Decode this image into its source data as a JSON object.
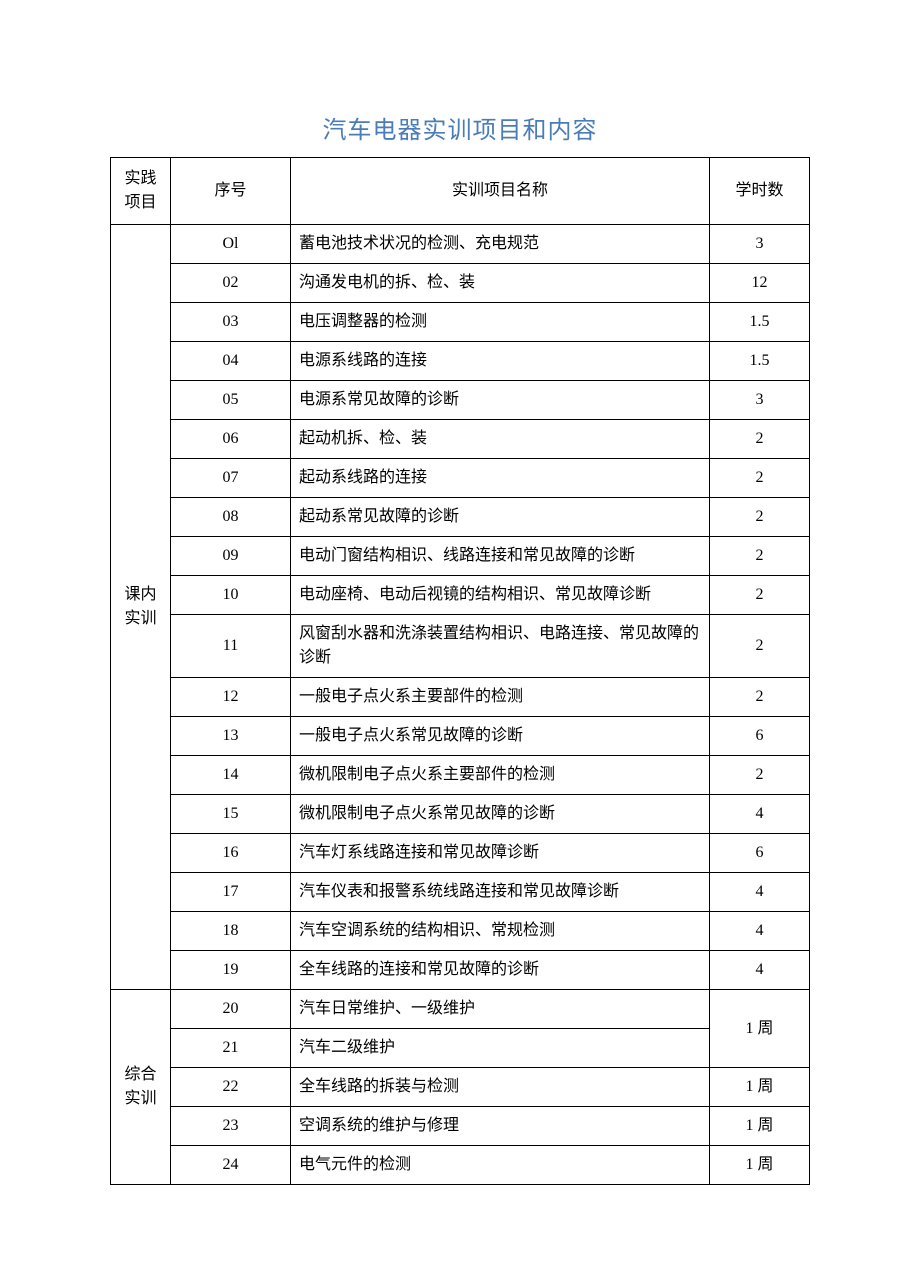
{
  "title": "汽车电器实训项目和内容",
  "headers": {
    "category": "实践项目",
    "index": "序号",
    "name": "实训项目名称",
    "hours": "学时数"
  },
  "groups": [
    {
      "category": "课内实训",
      "rows": [
        {
          "index": "Ol",
          "name": "蓄电池技术状况的检测、充电规范",
          "hours": "3"
        },
        {
          "index": "02",
          "name": "沟通发电机的拆、检、装",
          "hours": "12"
        },
        {
          "index": "03",
          "name": "电压调整器的检测",
          "hours": "1.5"
        },
        {
          "index": "04",
          "name": "电源系线路的连接",
          "hours": "1.5"
        },
        {
          "index": "05",
          "name": "电源系常见故障的诊断",
          "hours": "3"
        },
        {
          "index": "06",
          "name": "起动机拆、检、装",
          "hours": "2"
        },
        {
          "index": "07",
          "name": "起动系线路的连接",
          "hours": "2"
        },
        {
          "index": "08",
          "name": "起动系常见故障的诊断",
          "hours": "2"
        },
        {
          "index": "09",
          "name": "电动门窗结构相识、线路连接和常见故障的诊断",
          "hours": "2"
        },
        {
          "index": "10",
          "name": "电动座椅、电动后视镜的结构相识、常见故障诊断",
          "hours": "2"
        },
        {
          "index": "11",
          "name": "风窗刮水器和洗涤装置结构相识、电路连接、常见故障的诊断",
          "hours": "2"
        },
        {
          "index": "12",
          "name": "一般电子点火系主要部件的检测",
          "hours": "2"
        },
        {
          "index": "13",
          "name": "一般电子点火系常见故障的诊断",
          "hours": "6"
        },
        {
          "index": "14",
          "name": "微机限制电子点火系主要部件的检测",
          "hours": "2"
        },
        {
          "index": "15",
          "name": "微机限制电子点火系常见故障的诊断",
          "hours": "4"
        },
        {
          "index": "16",
          "name": "汽车灯系线路连接和常见故障诊断",
          "hours": "6"
        },
        {
          "index": "17",
          "name": "汽车仪表和报警系统线路连接和常见故障诊断",
          "hours": "4"
        },
        {
          "index": "18",
          "name": "汽车空调系统的结构相识、常规检测",
          "hours": "4"
        },
        {
          "index": "19",
          "name": "全车线路的连接和常见故障的诊断",
          "hours": "4"
        }
      ]
    },
    {
      "category": "综合实训",
      "hoursMerge": [
        {
          "index": "20",
          "name": "汽车日常维护、一级维护",
          "hours": "1 周",
          "hoursRowspan": 2
        },
        {
          "index": "21",
          "name": "汽车二级维护"
        },
        {
          "index": "22",
          "name": "全车线路的拆装与检测",
          "hours": "1 周"
        },
        {
          "index": "23",
          "name": "空调系统的维护与修理",
          "hours": "1 周"
        },
        {
          "index": "24",
          "name": "电气元件的检测",
          "hours": "1 周"
        }
      ]
    }
  ]
}
